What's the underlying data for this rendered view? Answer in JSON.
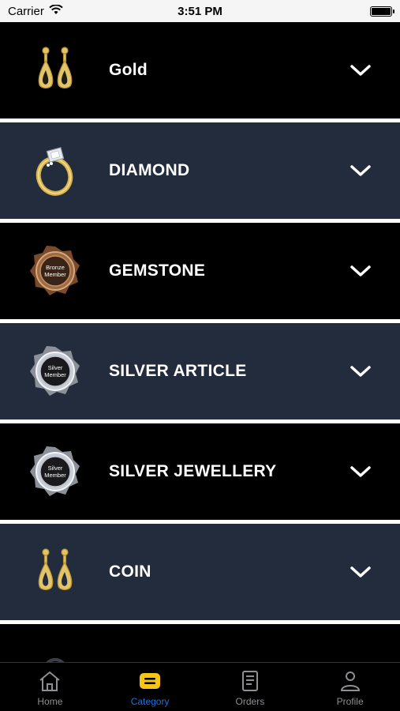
{
  "status": {
    "carrier": "Carrier",
    "time": "3:51 PM"
  },
  "categories": [
    {
      "label": "Gold",
      "icon": "earrings-icon"
    },
    {
      "label": "DIAMOND",
      "icon": "ring-icon"
    },
    {
      "label": "GEMSTONE",
      "icon": "bronze-member-badge-icon"
    },
    {
      "label": "SILVER ARTICLE",
      "icon": "silver-member-badge-icon"
    },
    {
      "label": "SILVER JEWELLERY",
      "icon": "silver-member-badge-icon"
    },
    {
      "label": "COIN",
      "icon": "earrings-icon"
    }
  ],
  "badges": {
    "bronze": [
      "Bronze",
      "Member"
    ],
    "silver": [
      "Silver",
      "Member"
    ]
  },
  "tabs": [
    {
      "label": "Home",
      "icon": "home-icon"
    },
    {
      "label": "Category",
      "icon": "category-icon",
      "active": true
    },
    {
      "label": "Orders",
      "icon": "orders-icon"
    },
    {
      "label": "Profile",
      "icon": "profile-icon"
    }
  ],
  "colors": {
    "row_dark": "#000000",
    "row_navy": "#232c3c",
    "active_tab": "#1e6fe0",
    "category_icon": "#f5c518"
  }
}
